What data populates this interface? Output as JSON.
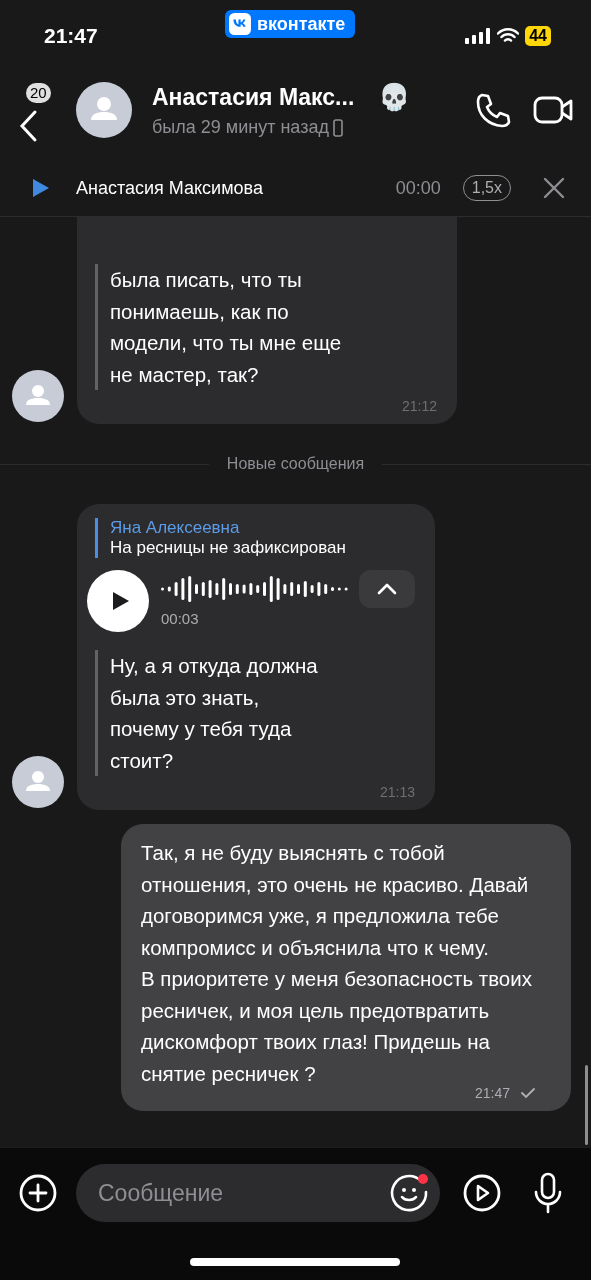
{
  "status_bar": {
    "time": "21:47",
    "app_badge": "вконтакте",
    "battery": "44"
  },
  "header": {
    "back_count": "20",
    "name": "Анастасия Макс...",
    "emoji": "💀",
    "last_seen": "была 29 минут назад"
  },
  "player": {
    "title": "Анастасия Максимова",
    "time": "00:00",
    "speed": "1,5x"
  },
  "messages": [
    {
      "kind": "incoming",
      "cut_top": true,
      "forwarded_text": "была писать, что ты понимаешь, как по модели, что ты мне еще не мастер, так?",
      "time": "21:12"
    },
    {
      "kind": "divider",
      "text": "Новые сообщения"
    },
    {
      "kind": "incoming",
      "cut_top": false,
      "reply": {
        "author": "Яна Алексеевна",
        "text": "На ресницы не зафиксирован"
      },
      "audio": {
        "duration": "00:03"
      },
      "forwarded_text": "Ну, а я откуда должна была это знать,\nпочему у тебя туда стоит?",
      "time": "21:13"
    },
    {
      "kind": "outgoing",
      "text": "Так, я не буду выяснять с тобой отношения, это очень не красиво. Давай договоримся уже, я предложила тебе компромисс и объяснила что к чему.\nВ приоритете у меня безопасность твоих ресничек, и моя цель предотвратить дискомфорт твоих глаз! Придешь на снятие ресничек ?",
      "time": "21:47",
      "read": true
    }
  ],
  "composer": {
    "placeholder": "Сообщение",
    "emoji_notification": true
  }
}
